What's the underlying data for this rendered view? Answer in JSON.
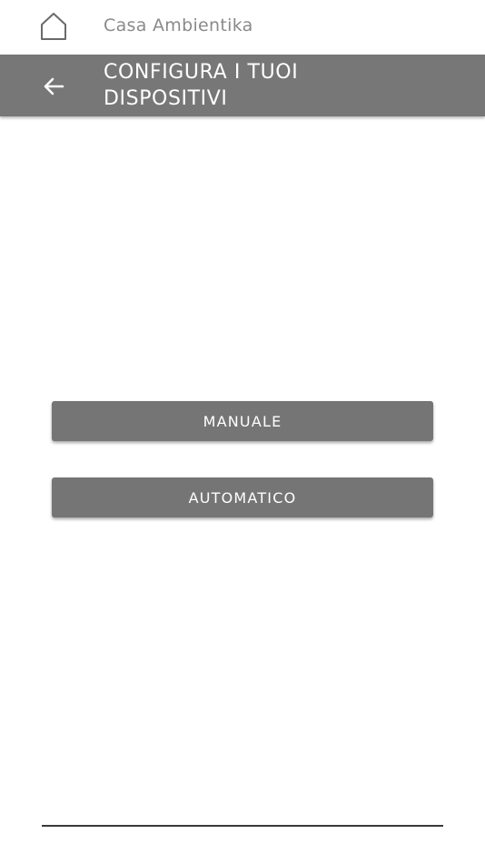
{
  "topbar": {
    "home_icon": "home-icon",
    "app_name": "Casa Ambientika"
  },
  "header": {
    "back_icon": "arrow-left-icon",
    "title_line1": "CONFIGURA I TUOI",
    "title_line2": "DISPOSITIVI",
    "background_color": "#777777"
  },
  "actions": {
    "manuale_label": "MANUALE",
    "automatico_label": "AUTOMATICO",
    "button_color": "#757575"
  }
}
